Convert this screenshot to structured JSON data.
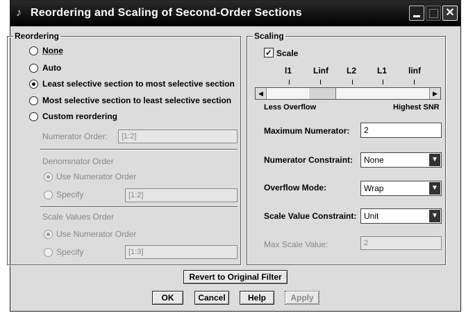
{
  "window": {
    "title": "Reordering and Scaling of Second-Order Sections",
    "close_glyph": "✕"
  },
  "reordering": {
    "legend": "Reordering",
    "options": [
      {
        "label": "None",
        "selected": false
      },
      {
        "label": "Auto",
        "selected": false
      },
      {
        "label": "Least selective section to most selective section",
        "selected": true
      },
      {
        "label": "Most selective section to least selective section",
        "selected": false
      },
      {
        "label": "Custom reordering",
        "selected": false
      }
    ],
    "numerator_order": {
      "label": "Numerator Order:",
      "value": "[1:2]"
    },
    "denominator_order": {
      "heading": "Denominator Order",
      "use_numerator_label": "Use Numerator Order",
      "specify_label": "Specify",
      "specify_value": "[1:2]"
    },
    "scale_values_order": {
      "heading": "Scale Values Order",
      "use_numerator_label": "Use Numerator Order",
      "specify_label": "Specify",
      "specify_value": "[1:3]"
    }
  },
  "scaling": {
    "legend": "Scaling",
    "scale_checkbox": {
      "label": "Scale",
      "checked": true,
      "glyph": "✓"
    },
    "slider": {
      "ticks": [
        "l1",
        "Linf",
        "L2",
        "L1",
        "linf"
      ],
      "left_label": "Less Overflow",
      "right_label": "Highest SNR",
      "left_arrow": "◀",
      "right_arrow": "▶"
    },
    "max_numerator": {
      "label": "Maximum Numerator:",
      "value": "2"
    },
    "numerator_constraint": {
      "label": "Numerator Constraint:",
      "value": "None"
    },
    "overflow_mode": {
      "label": "Overflow Mode:",
      "value": "Wrap"
    },
    "scale_value_constraint": {
      "label": "Scale Value Constraint:",
      "value": "Unit"
    },
    "max_scale_value": {
      "label": "Max Scale Value:",
      "value": "2"
    },
    "dropdown_glyph": "▼"
  },
  "buttons": {
    "revert": "Revert to Original Filter",
    "ok": "OK",
    "cancel": "Cancel",
    "help": "Help",
    "apply": "Apply"
  }
}
